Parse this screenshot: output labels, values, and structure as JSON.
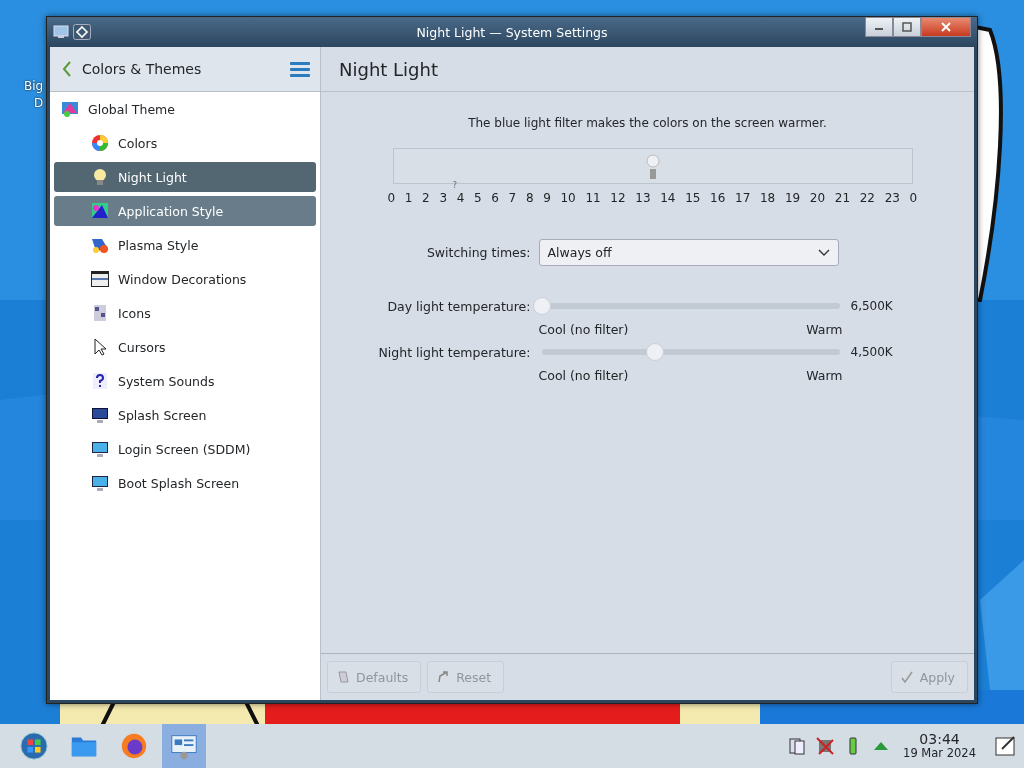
{
  "desktop": {
    "icon_label_lines": [
      "Big",
      "D"
    ]
  },
  "window": {
    "title": "Night Light — System Settings"
  },
  "sidebar": {
    "back_title": "Colors & Themes",
    "items": [
      {
        "label": "Global Theme",
        "kind": "global",
        "selected": false,
        "hovered": false,
        "children": [
          {
            "label": "Colors",
            "kind": "colors",
            "selected": false,
            "hovered": false
          },
          {
            "label": "Night Light",
            "kind": "bulb",
            "selected": true,
            "hovered": false
          },
          {
            "label": "Application Style",
            "kind": "appstyle",
            "selected": false,
            "hovered": true
          },
          {
            "label": "Plasma Style",
            "kind": "plasma",
            "selected": false,
            "hovered": false
          },
          {
            "label": "Window Decorations",
            "kind": "windeco",
            "selected": false,
            "hovered": false
          },
          {
            "label": "Icons",
            "kind": "icons",
            "selected": false,
            "hovered": false
          },
          {
            "label": "Cursors",
            "kind": "cursor",
            "selected": false,
            "hovered": false
          },
          {
            "label": "System Sounds",
            "kind": "sounds",
            "selected": false,
            "hovered": false
          },
          {
            "label": "Splash Screen",
            "kind": "monitor",
            "selected": false,
            "hovered": false
          },
          {
            "label": "Login Screen (SDDM)",
            "kind": "monitor2",
            "selected": false,
            "hovered": false
          },
          {
            "label": "Boot Splash Screen",
            "kind": "monitor2",
            "selected": false,
            "hovered": false
          }
        ]
      }
    ]
  },
  "page": {
    "title": "Night Light",
    "description": "The blue light filter makes the colors on the screen warmer.",
    "timeline": {
      "level": 0.5,
      "hours": [
        {
          "label": "0"
        },
        {
          "label": "1"
        },
        {
          "label": "2"
        },
        {
          "label": "3"
        },
        {
          "label": "4",
          "mark": "?"
        },
        {
          "label": "5"
        },
        {
          "label": "6"
        },
        {
          "label": "7"
        },
        {
          "label": "8"
        },
        {
          "label": "9"
        },
        {
          "label": "10"
        },
        {
          "label": "11"
        },
        {
          "label": "12"
        },
        {
          "label": "13"
        },
        {
          "label": "14"
        },
        {
          "label": "15"
        },
        {
          "label": "16"
        },
        {
          "label": "17"
        },
        {
          "label": "18"
        },
        {
          "label": "19"
        },
        {
          "label": "20"
        },
        {
          "label": "21"
        },
        {
          "label": "22"
        },
        {
          "label": "23"
        },
        {
          "label": "0"
        }
      ]
    },
    "switching_times": {
      "label": "Switching times:",
      "value": "Always off"
    },
    "sliders": [
      {
        "label": "Day light temperature:",
        "level": 0.0,
        "reading": "6,500K",
        "min_label": "Cool (no filter)",
        "max_label": "Warm"
      },
      {
        "label": "Night light temperature:",
        "level": 0.37,
        "reading": "4,500K",
        "min_label": "Cool (no filter)",
        "max_label": "Warm"
      }
    ]
  },
  "footer": {
    "buttons": [
      {
        "label": "Defaults",
        "kind": "defaults",
        "disabled": true
      },
      {
        "label": "Reset",
        "kind": "reset",
        "disabled": true
      },
      {
        "label": "Apply",
        "kind": "apply",
        "disabled": true
      }
    ]
  },
  "taskbar": {
    "apps": [
      {
        "kind": "start",
        "selected": false
      },
      {
        "kind": "folder",
        "selected": false
      },
      {
        "kind": "browser",
        "selected": false
      },
      {
        "kind": "settings",
        "selected": true
      }
    ],
    "clock": {
      "time": "03:44",
      "date": "19 Mar 2024"
    }
  }
}
